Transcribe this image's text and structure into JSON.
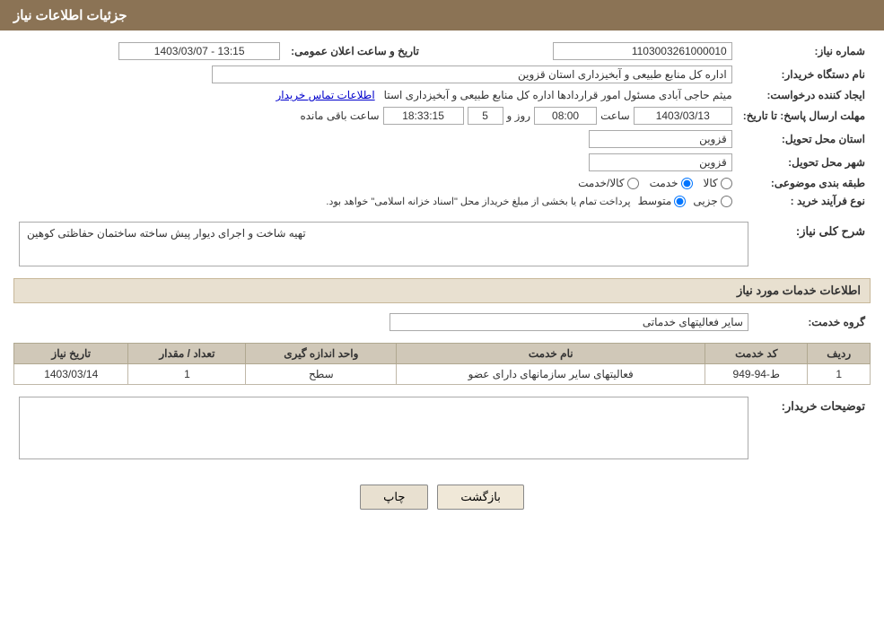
{
  "header": {
    "title": "جزئیات اطلاعات نیاز"
  },
  "fields": {
    "need_number_label": "شماره نیاز:",
    "need_number_value": "1103003261000010",
    "buyer_org_label": "نام دستگاه خریدار:",
    "buyer_org_value": "اداره کل منابع طبیعی و آبخیزداری استان قزوین",
    "creator_label": "ایجاد کننده درخواست:",
    "creator_value": "میثم حاجی آبادی مسئول امور قراردادها اداره کل منابع طبیعی و آبخیزداری استا",
    "creator_link": "اطلاعات تماس خریدار",
    "deadline_label": "مهلت ارسال پاسخ: تا تاریخ:",
    "deadline_date": "1403/03/13",
    "deadline_time_label": "ساعت",
    "deadline_time": "08:00",
    "deadline_day_label": "روز و",
    "deadline_days": "5",
    "deadline_remain_label": "ساعت باقی مانده",
    "deadline_remain": "18:33:15",
    "announce_label": "تاریخ و ساعت اعلان عمومی:",
    "announce_value": "1403/03/07 - 13:15",
    "province_label": "استان محل تحویل:",
    "province_value": "قزوین",
    "city_label": "شهر محل تحویل:",
    "city_value": "قزوین",
    "category_label": "طبقه بندی موضوعی:",
    "cat_option1": "کالا",
    "cat_option2": "خدمت",
    "cat_option3": "کالا/خدمت",
    "process_label": "نوع فرآیند خرید :",
    "process_option1": "جزیی",
    "process_option2": "متوسط",
    "process_desc": "پرداخت تمام یا بخشی از مبلغ خریداز محل \"اسناد خزانه اسلامی\" خواهد بود.",
    "need_desc_label": "شرح کلی نیاز:",
    "need_desc_value": "تهیه شاخت و اجرای دیوار پیش ساخته ساختمان حفاظتی کوهین",
    "services_label": "اطلاعات خدمات مورد نیاز",
    "service_group_label": "گروه خدمت:",
    "service_group_value": "سایر فعالیتهای خدماتی",
    "table_headers": [
      "ردیف",
      "کد خدمت",
      "نام خدمت",
      "واحد اندازه گیری",
      "تعداد / مقدار",
      "تاریخ نیاز"
    ],
    "table_rows": [
      {
        "row": "1",
        "code": "ط-94-949",
        "name": "فعالیتهای سایر سازمانهای دارای عضو",
        "unit": "سطح",
        "qty": "1",
        "date": "1403/03/14"
      }
    ],
    "buyer_desc_label": "توضیحات خریدار:",
    "buyer_desc_value": "",
    "btn_print": "چاپ",
    "btn_back": "بازگشت"
  }
}
